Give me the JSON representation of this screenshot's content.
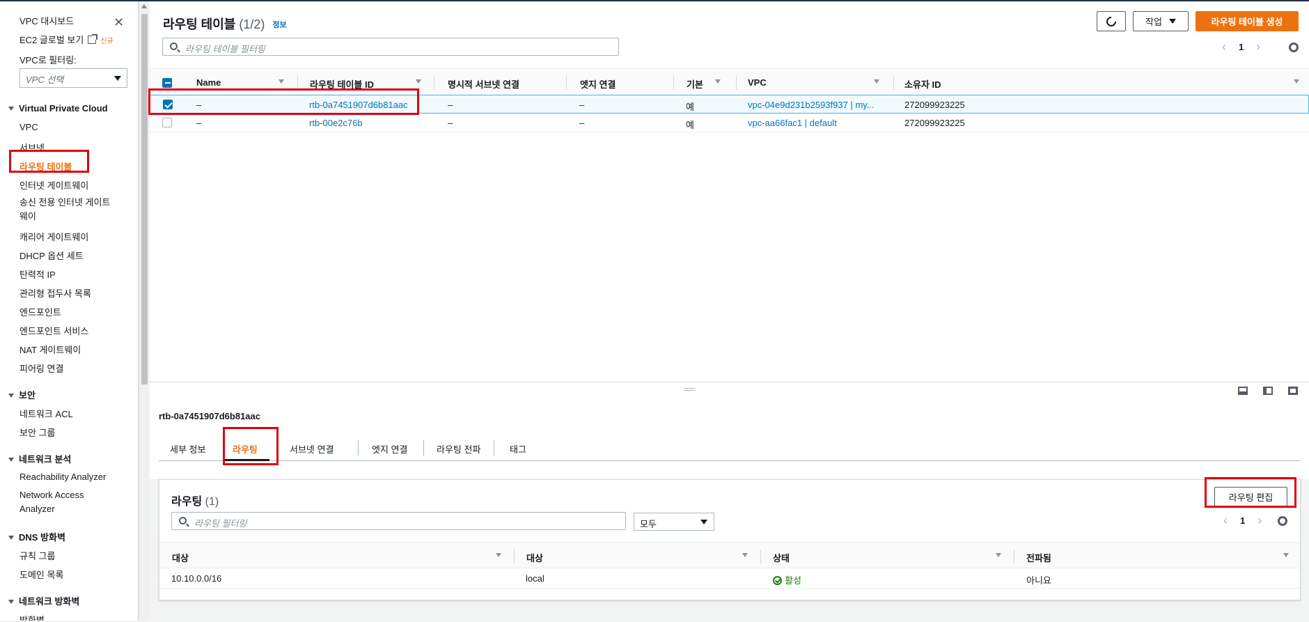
{
  "sidebar": {
    "dashboard": "VPC 대시보드",
    "ec2_global": "EC2 글로벌 보기",
    "new_badge": "신규",
    "filter_label": "VPC로 필터링:",
    "filter_placeholder": "VPC 선택",
    "section_vpc": "Virtual Private Cloud",
    "vpc_items": [
      "VPC",
      "서브넷",
      "라우팅 테이블",
      "인터넷 게이트웨이",
      "송신 전용 인터넷 게이트웨이",
      "캐리어 게이트웨이",
      "DHCP 옵션 세트",
      "탄력적 IP",
      "관리형 접두사 목록",
      "엔드포인트",
      "엔드포인트 서비스",
      "NAT 게이트웨이",
      "피어링 연결"
    ],
    "section_security": "보안",
    "security_items": [
      "네트워크 ACL",
      "보안 그룹"
    ],
    "section_netanalysis": "네트워크 분석",
    "netanalysis_items": [
      "Reachability Analyzer",
      "Network Access Analyzer"
    ],
    "section_dns": "DNS 방화벽",
    "dns_items": [
      "규칙 그룹",
      "도메인 목록"
    ],
    "section_netfw": "네트워크 방화벽",
    "netfw_items": [
      "방화벽"
    ]
  },
  "top": {
    "title": "라우팅 테이블",
    "count": "(1/2)",
    "info": "정보",
    "actions_label": "작업",
    "create_label": "라우팅 테이블 생성",
    "search_placeholder": "라우팅 테이블 필터링",
    "page": "1",
    "columns": [
      "Name",
      "라우팅 테이블 ID",
      "명시적 서브넷 연결",
      "엣지 연결",
      "기본",
      "VPC",
      "소유자 ID"
    ],
    "rows": [
      {
        "name": "–",
        "id": "rtb-0a7451907d6b81aac",
        "subnet": "–",
        "edge": "–",
        "main": "예",
        "vpc": "vpc-04e9d231b2593f937 | my...",
        "owner": "272099923225",
        "selected": true
      },
      {
        "name": "–",
        "id": "rtb-00e2c76b",
        "subnet": "–",
        "edge": "–",
        "main": "예",
        "vpc": "vpc-aa66fac1 | default",
        "owner": "272099923225",
        "selected": false
      }
    ]
  },
  "bottom": {
    "selected_id": "rtb-0a7451907d6b81aac",
    "tabs": [
      "세부 정보",
      "라우팅",
      "서브넷 연결",
      "엣지 연결",
      "라우팅 전파",
      "태그"
    ],
    "active_tab": 1,
    "card_title": "라우팅",
    "card_count": "(1)",
    "edit_routes": "라우팅 편집",
    "route_search_placeholder": "라우팅 필터링",
    "filter_select": "모두",
    "page": "1",
    "columns": [
      "대상",
      "대상",
      "상태",
      "전파됨"
    ],
    "rows": [
      {
        "destination": "10.10.0.0/16",
        "target": "local",
        "status": "활성",
        "propagated": "아니요"
      }
    ]
  },
  "colors": {
    "accent": "#ec7211",
    "link": "#0073bb",
    "highlight": "#e0000f",
    "success": "#1d8102"
  }
}
